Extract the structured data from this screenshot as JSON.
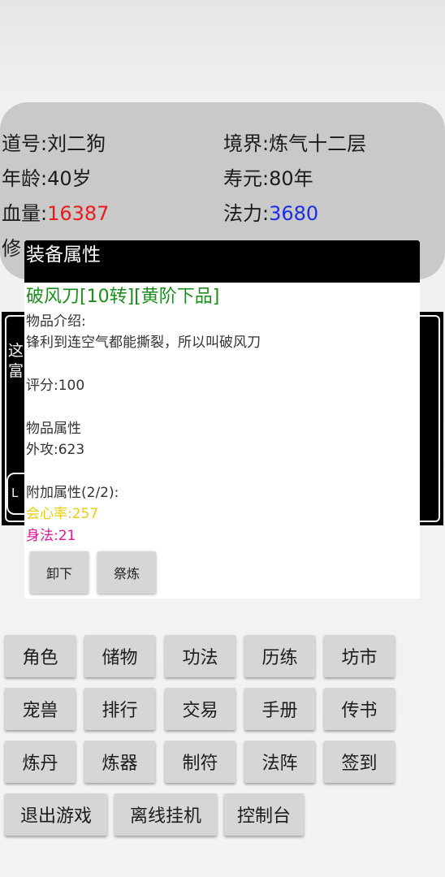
{
  "status": {
    "dao_name": "道号:刘二狗",
    "realm": "境界:炼气十二层",
    "age": "年龄:40岁",
    "lifespan": "寿元:80年",
    "hp_label": "血量:",
    "hp_value": "16387",
    "mp_label": "法力:",
    "mp_value": "3680",
    "cultivation_partial": "修"
  },
  "event": {
    "line1_partial": "这",
    "line2_partial": "富",
    "button_partial": "L"
  },
  "dialog": {
    "title": "装备属性",
    "item_name": "破风刀[10转][黄阶下品]",
    "intro_label": "物品介绍:",
    "intro_text": "锋利到连空气都能撕裂，所以叫破风刀",
    "score": "评分:100",
    "attr_label": "物品属性",
    "outer_attack": "外攻:623",
    "extra_label": "附加属性(2/2):",
    "extra_1": "会心率:257",
    "extra_2": "身法:21",
    "btn_unequip": "卸下",
    "btn_refine": "祭炼",
    "colors": {
      "item_name": "#1e8c1e",
      "extra_1": "#e8cf10",
      "extra_2": "#e0169c"
    }
  },
  "menu": {
    "row1": [
      "角色",
      "储物",
      "功法",
      "历练",
      "坊市"
    ],
    "row2": [
      "宠兽",
      "排行",
      "交易",
      "手册",
      "传书"
    ],
    "row3": [
      "炼丹",
      "炼器",
      "制符",
      "法阵",
      "签到"
    ],
    "row4": [
      "退出游戏",
      "离线挂机",
      "控制台"
    ]
  },
  "colors": {
    "hp": "#f01a1a",
    "mp": "#1a2ee8",
    "panel_bg": "#c9c9c9",
    "button_bg": "#d6d6d6"
  }
}
